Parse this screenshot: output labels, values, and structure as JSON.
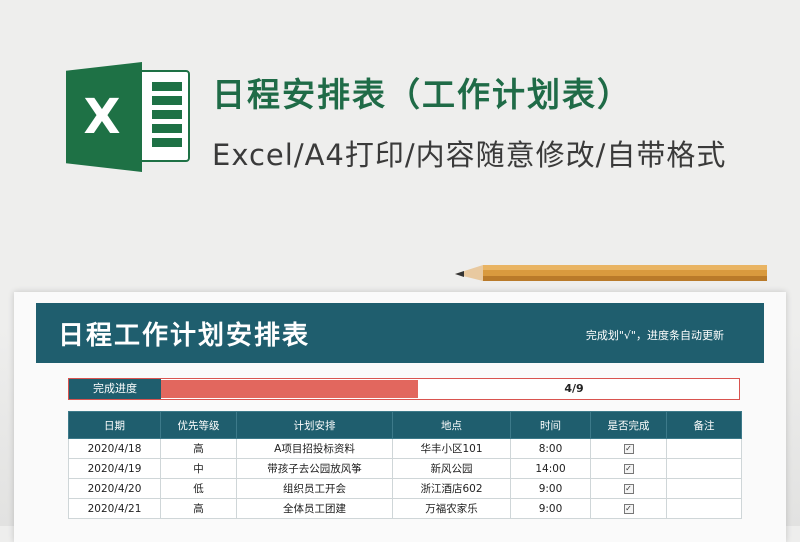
{
  "header": {
    "title": "日程安排表（工作计划表）",
    "subtitle": "Excel/A4打印/内容随意修改/自带格式",
    "logo_letter": "X"
  },
  "sheet": {
    "banner_title": "日程工作计划安排表",
    "banner_note": "完成划\"√\"，进度条自动更新",
    "progress_label": "完成进度",
    "progress_value": "4/9",
    "progress_fraction": 0.444,
    "columns": [
      "日期",
      "优先等级",
      "计划安排",
      "地点",
      "时间",
      "是否完成",
      "备注"
    ],
    "rows": [
      {
        "date": "2020/4/18",
        "priority": "高",
        "plan": "A项目招投标资料",
        "place": "华丰小区101",
        "time": "8:00",
        "done": "✓",
        "note": ""
      },
      {
        "date": "2020/4/19",
        "priority": "中",
        "plan": "带孩子去公园放风筝",
        "place": "新风公园",
        "time": "14:00",
        "done": "✓",
        "note": ""
      },
      {
        "date": "2020/4/20",
        "priority": "低",
        "plan": "组织员工开会",
        "place": "浙江酒店602",
        "time": "9:00",
        "done": "✓",
        "note": ""
      },
      {
        "date": "2020/4/21",
        "priority": "高",
        "plan": "全体员工团建",
        "place": "万福农家乐",
        "time": "9:00",
        "done": "✓",
        "note": ""
      }
    ]
  },
  "colors": {
    "banner": "#1f5e6e",
    "progress_fill": "#e2675e",
    "title_green": "#1f6b47",
    "excel_green": "#1e7145"
  },
  "icons": {
    "logo": "excel-logo-icon",
    "pencil": "pencil-icon",
    "checkbox": "checkbox-checked-icon"
  }
}
